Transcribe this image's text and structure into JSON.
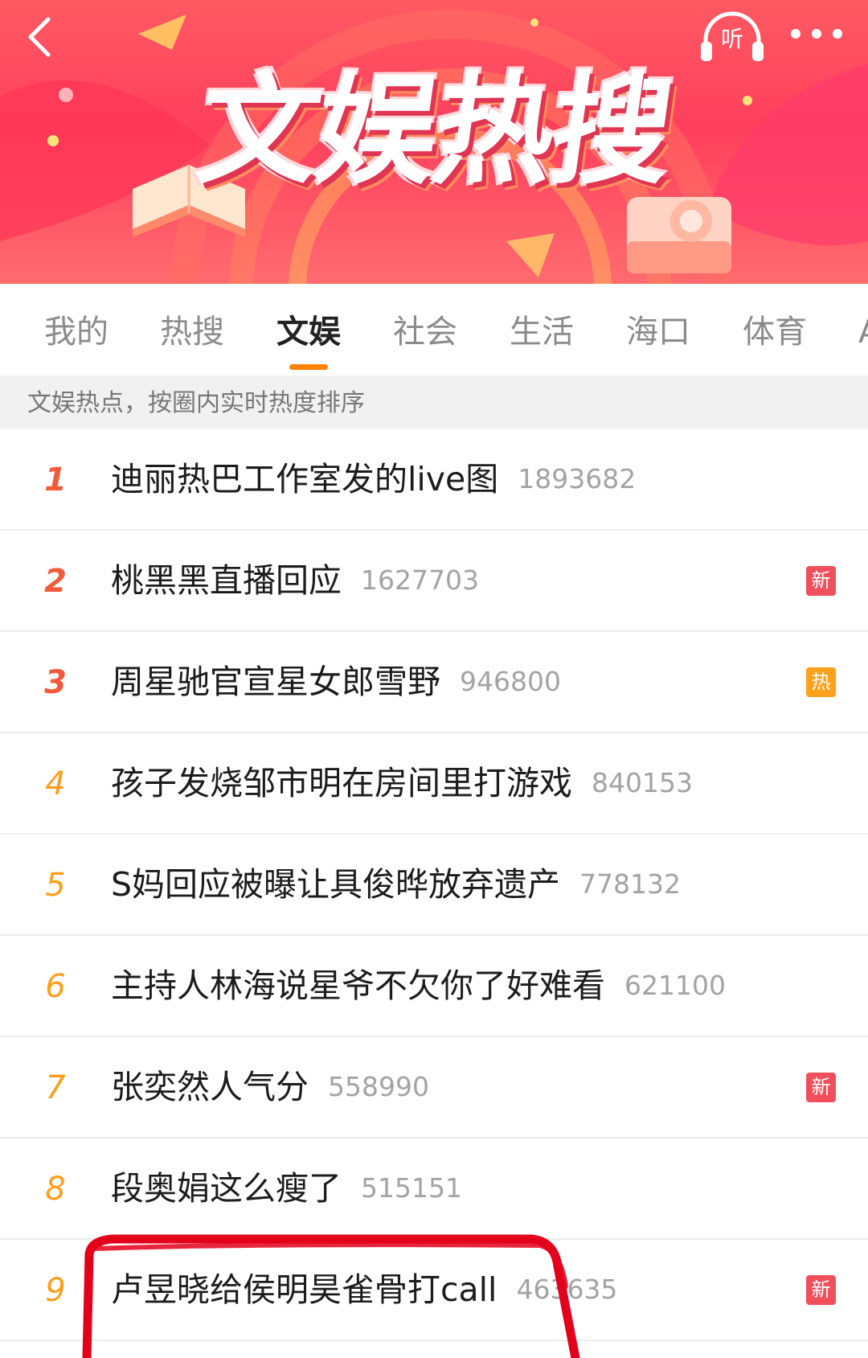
{
  "header": {
    "title": "文娱热搜",
    "listen_label": "听",
    "back_icon": "chevron-left-icon",
    "listen_icon": "headphones-icon",
    "more_icon": "more-icon"
  },
  "tabs": [
    {
      "label": "我的"
    },
    {
      "label": "热搜"
    },
    {
      "label": "文娱",
      "active": true
    },
    {
      "label": "社会"
    },
    {
      "label": "生活"
    },
    {
      "label": "海口"
    },
    {
      "label": "体育"
    },
    {
      "label": "A"
    }
  ],
  "subheader": "文娱热点，按圈内实时热度排序",
  "items": [
    {
      "rank": "1",
      "topic": "迪丽热巴工作室发的live图",
      "count": "1893682",
      "badge": ""
    },
    {
      "rank": "2",
      "topic": "桃黑黑直播回应",
      "count": "1627703",
      "badge": "新"
    },
    {
      "rank": "3",
      "topic": "周星驰官宣星女郎雪野",
      "count": "946800",
      "badge": "热"
    },
    {
      "rank": "4",
      "topic": "孩子发烧邹市明在房间里打游戏",
      "count": "840153",
      "badge": ""
    },
    {
      "rank": "5",
      "topic": "S妈回应被曝让具俊晔放弃遗产",
      "count": "778132",
      "badge": ""
    },
    {
      "rank": "6",
      "topic": "主持人林海说星爷不欠你了好难看",
      "count": "621100",
      "badge": ""
    },
    {
      "rank": "7",
      "topic": "张奕然人气分",
      "count": "558990",
      "badge": "新"
    },
    {
      "rank": "8",
      "topic": "段奥娟这么瘦了",
      "count": "515151",
      "badge": ""
    },
    {
      "rank": "9",
      "topic": "卢昱晓给侯明昊雀骨打call",
      "count": "463635",
      "badge": "新"
    }
  ],
  "colors": {
    "accent": "#ff8200",
    "rank_top": "#f25a3c",
    "rank_mid": "#ff9e1b",
    "badge_new": "#f0505c",
    "badge_hot": "#ffa11a",
    "annotation": "#e3001b"
  }
}
